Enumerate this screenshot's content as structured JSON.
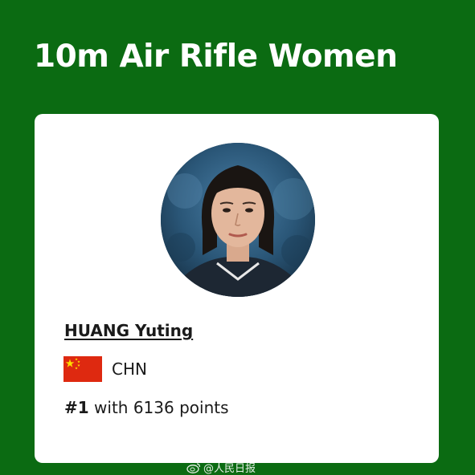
{
  "event": {
    "title": "10m Air Rifle Women"
  },
  "athlete": {
    "name": "HUANG Yuting",
    "country_code": "CHN",
    "flag_icon": "china-flag-icon",
    "rank": "#1",
    "points_text": "with 6136 points"
  },
  "watermark": {
    "text": "@人民日报",
    "icon": "weibo-icon"
  },
  "colors": {
    "background": "#0b6b12",
    "card": "#ffffff",
    "text": "#1a1a1a",
    "flag_red": "#de2910",
    "flag_star": "#ffde00"
  }
}
